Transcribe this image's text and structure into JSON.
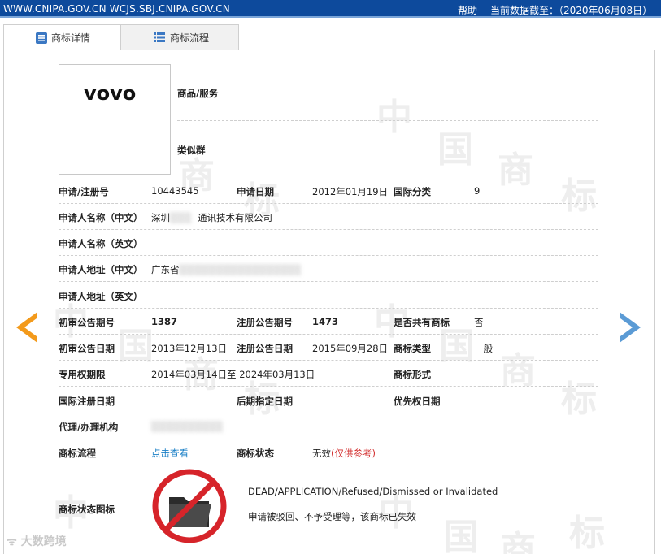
{
  "topbar": {
    "site": "WWW.CNIPA.GOV.CN WCJS.SBJ.CNIPA.GOV.CN",
    "help": "帮助",
    "as_of": "当前数据截至：（2020年06月08日）"
  },
  "tabs": [
    {
      "label": "商标详情",
      "active": true,
      "icon": "document-icon"
    },
    {
      "label": "商标流程",
      "active": false,
      "icon": "list-icon"
    }
  ],
  "logo": {
    "text": "vovo"
  },
  "fields": {
    "goods_services_label": "商品/服务",
    "similar_group_label": "类似群",
    "reg_no_label": "申请/注册号",
    "reg_no": "10443545",
    "apply_date_label": "申请日期",
    "apply_date": "2012年01月19日",
    "intl_class_label": "国际分类",
    "intl_class": "9",
    "applicant_cn_label": "申请人名称（中文）",
    "applicant_cn": "深圳",
    "applicant_cn_tail": "通讯技术有限公司",
    "applicant_en_label": "申请人名称（英文）",
    "addr_cn_label": "申请人地址（中文）",
    "addr_cn": "广东省",
    "addr_en_label": "申请人地址（英文）",
    "prelim_issue_label": "初审公告期号",
    "prelim_issue": "1387",
    "reg_issue_label": "注册公告期号",
    "reg_issue": "1473",
    "shared_label": "是否共有商标",
    "shared": "否",
    "prelim_date_label": "初审公告日期",
    "prelim_date": "2013年12月13日",
    "reg_date_label": "注册公告日期",
    "reg_date": "2015年09月28日",
    "tm_type_label": "商标类型",
    "tm_type": "一般",
    "exclusive_label": "专用权期限",
    "exclusive": "2014年03月14日至 2024年03月13日",
    "tm_form_label": "商标形式",
    "intl_reg_date_label": "国际注册日期",
    "later_date_label": "后期指定日期",
    "priority_date_label": "优先权日期",
    "agent_label": "代理/办理机构",
    "process_label": "商标流程",
    "process_link": "点击查看",
    "status_label": "商标状态",
    "status": "无效",
    "status_note": "(仅供参考)",
    "status_icon_label": "商标状态图标",
    "status_en": "DEAD/APPLICATION/Refused/Dismissed or Invalidated",
    "status_cn": "申请被驳回、不予受理等，该商标已失效"
  },
  "watermark": {
    "chars": [
      "中",
      "国",
      "商",
      "标"
    ],
    "bottom_text": "大数跨境"
  },
  "colors": {
    "topbar": "#0d4a9c",
    "link": "#1a7fc6",
    "invalid": "#d32f2f",
    "prev_arrow": "#f39a1b",
    "next_arrow": "#5b9bd5"
  }
}
